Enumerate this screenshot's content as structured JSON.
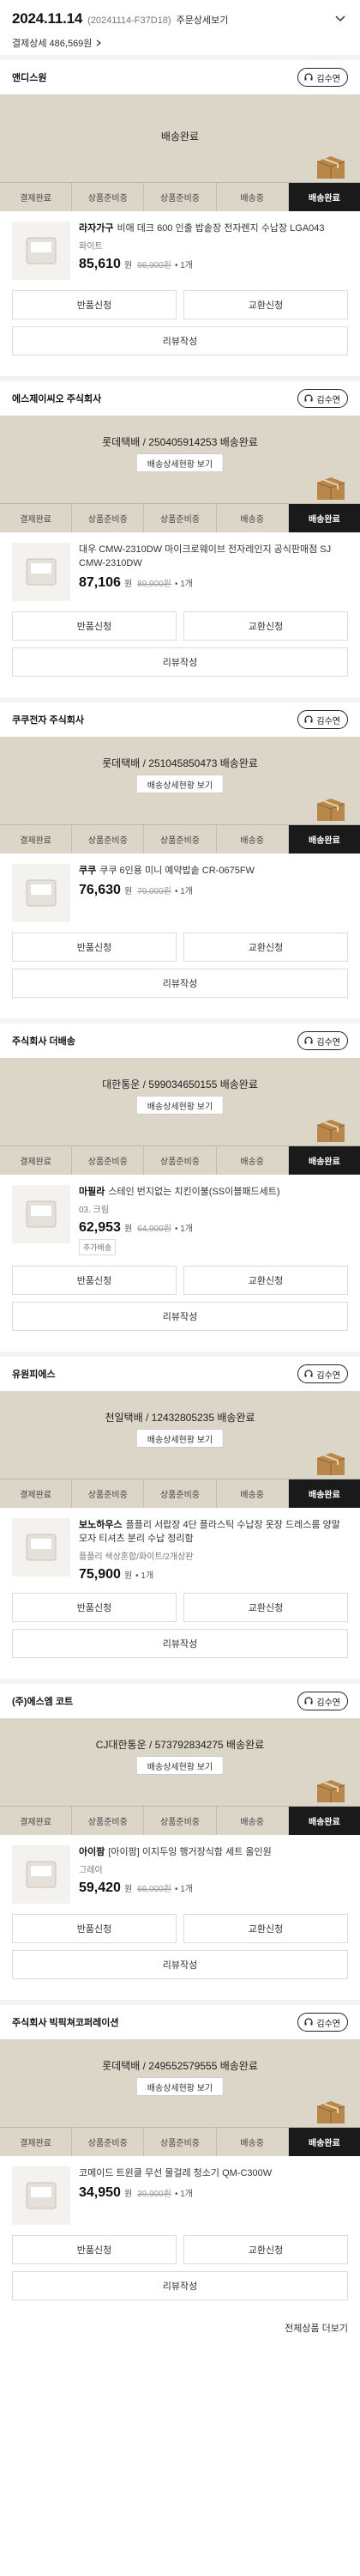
{
  "header": {
    "date": "2024.11.14",
    "order_no": "(20241114-F37D18)",
    "detail_link": "주문상세보기",
    "payment": "결제상세 486,569원"
  },
  "steps": [
    "결제완료",
    "상품준비중",
    "상품준비중",
    "배송중",
    "배송완료"
  ],
  "labels": {
    "cs_button": "김수연",
    "track_button": "배송상세현황 보기",
    "return": "반품신청",
    "exchange": "교환신청",
    "review": "리뷰작성",
    "won": "원",
    "more": "전체상품 더보기"
  },
  "orders": [
    {
      "seller": "앤디스원",
      "status": "배송완료",
      "has_track": false,
      "brand": "라자가구",
      "product": "비애 데크 600 인출 밥솥장 전자렌지 수납장 LGA043",
      "option": "화이트",
      "price": "85,610",
      "orig": "96,900원",
      "qty": "1개",
      "tag": ""
    },
    {
      "seller": "에스제이씨오 주식회사",
      "status": "롯데택배 / 250405914253 배송완료",
      "has_track": true,
      "brand": "",
      "product": "대우 CMW-2310DW 마이크로웨이브 전자레인지 공식판매점 SJ CMW-2310DW",
      "option": "",
      "price": "87,106",
      "orig": "89,900원",
      "qty": "1개",
      "tag": ""
    },
    {
      "seller": "쿠쿠전자 주식회사",
      "status": "롯데택배 / 251045850473 배송완료",
      "has_track": true,
      "brand": "쿠쿠",
      "product": "쿠쿠 6인용 미니 예약밥솥 CR-0675FW",
      "option": "",
      "price": "76,630",
      "orig": "79,000원",
      "qty": "1개",
      "tag": ""
    },
    {
      "seller": "주식회사 더배송",
      "status": "대한통운 / 599034650155 배송완료",
      "has_track": true,
      "brand": "마필라",
      "product": "스테인 번지없는 치킨이불(SS이블패드세트)",
      "option": "03. 크림",
      "price": "62,953",
      "orig": "64,900원",
      "qty": "1개",
      "tag": "추가배송"
    },
    {
      "seller": "유원피에스",
      "status": "천일택배 / 12432805235 배송완료",
      "has_track": true,
      "brand": "보노하우스",
      "product": "플플리 서랍장 4단 플라스틱 수납장 옷장 드레스룸 양말 모자 티셔츠 분리 수납 정리함",
      "option": "플플리 색상혼합/화이트/2개상판",
      "price": "75,900",
      "orig": "",
      "qty": "1개",
      "tag": ""
    },
    {
      "seller": "(주)에스엠 코트",
      "status": "CJ대한통운 / 573792834275 배송완료",
      "has_track": true,
      "brand": "아이팜",
      "product": "[아이팜] 이지두잉 행거장식함 세트 올인원",
      "option": "그레이",
      "price": "59,420",
      "orig": "66,000원",
      "qty": "1개",
      "tag": ""
    },
    {
      "seller": "주식회사 빅픽쳐코퍼레이션",
      "status": "롯데택배 / 249552579555 배송완료",
      "has_track": true,
      "brand": "",
      "product": "코메이드 트윈클 무선 물걸레 청소기 QM-C300W",
      "option": "",
      "price": "34,950",
      "orig": "39,900원",
      "qty": "1개",
      "tag": ""
    }
  ],
  "colors": {
    "status_bg": "#dcd6c8",
    "active_step": "#1a1a1a"
  }
}
